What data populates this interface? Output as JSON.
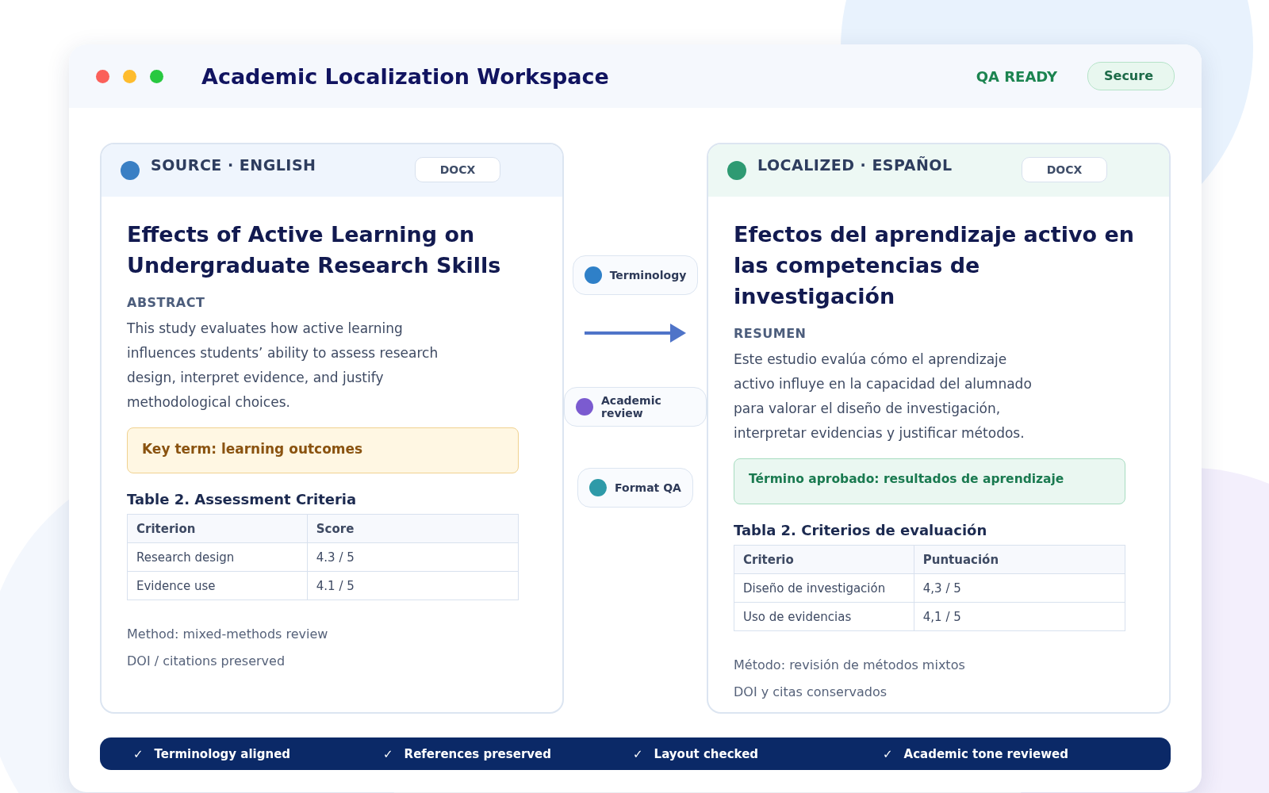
{
  "window": {
    "title": "Academic Localization Workspace",
    "status": "QA READY",
    "badge": "Secure"
  },
  "panels": [
    {
      "kind": "source",
      "label": "SOURCE · ENGLISH",
      "color": "#3a7fc4",
      "format": "DOCX",
      "title": "Effects of Active Learning on Undergraduate Research Skills",
      "section": "ABSTRACT",
      "abstract": "This study evaluates how active learning influences students’ ability to assess research design, interpret evidence, and justify methodological choices.",
      "note": "Key term: learning outcomes",
      "table": {
        "caption": "Table 2. Assessment Criteria",
        "columns": [
          "Criterion",
          "Score"
        ],
        "rows": [
          [
            "Research design",
            "4.3 / 5"
          ],
          [
            "Evidence use",
            "4.1 / 5"
          ]
        ]
      },
      "footnotes": [
        "Method: mixed-methods review",
        "DOI / citations preserved"
      ]
    },
    {
      "kind": "target",
      "label": "LOCALIZED · ESPAÑOL",
      "color": "#2e9a72",
      "format": "DOCX",
      "title": "Efectos del aprendizaje activo en las competencias de investigación",
      "section": "RESUMEN",
      "abstract": "Este estudio evalúa cómo el aprendizaje activo influye en la capacidad del alumnado para valorar el diseño de investigación, interpretar evidencias y justificar métodos.",
      "note": "Término aprobado: resultados de aprendizaje",
      "table": {
        "caption": "Tabla 2. Criterios de evaluación",
        "columns": [
          "Criterio",
          "Puntuación"
        ],
        "rows": [
          [
            "Diseño de investigación",
            "4,3 / 5"
          ],
          [
            "Uso de evidencias",
            "4,1 / 5"
          ]
        ]
      },
      "footnotes": [
        "Método: revisión de métodos mixtos",
        "DOI y citas conservados"
      ]
    }
  ],
  "checks": [
    {
      "label": "Terminology",
      "color": "#2f80c8"
    },
    {
      "label": "Academic review",
      "color": "#7b5bd0"
    },
    {
      "label": "Format QA",
      "color": "#2e9aa8"
    }
  ],
  "checklist": [
    {
      "mark": "✓",
      "label": "Terminology aligned"
    },
    {
      "mark": "✓",
      "label": "References preserved"
    },
    {
      "mark": "✓",
      "label": "Layout checked"
    },
    {
      "mark": "✓",
      "label": "Academic tone reviewed"
    }
  ]
}
